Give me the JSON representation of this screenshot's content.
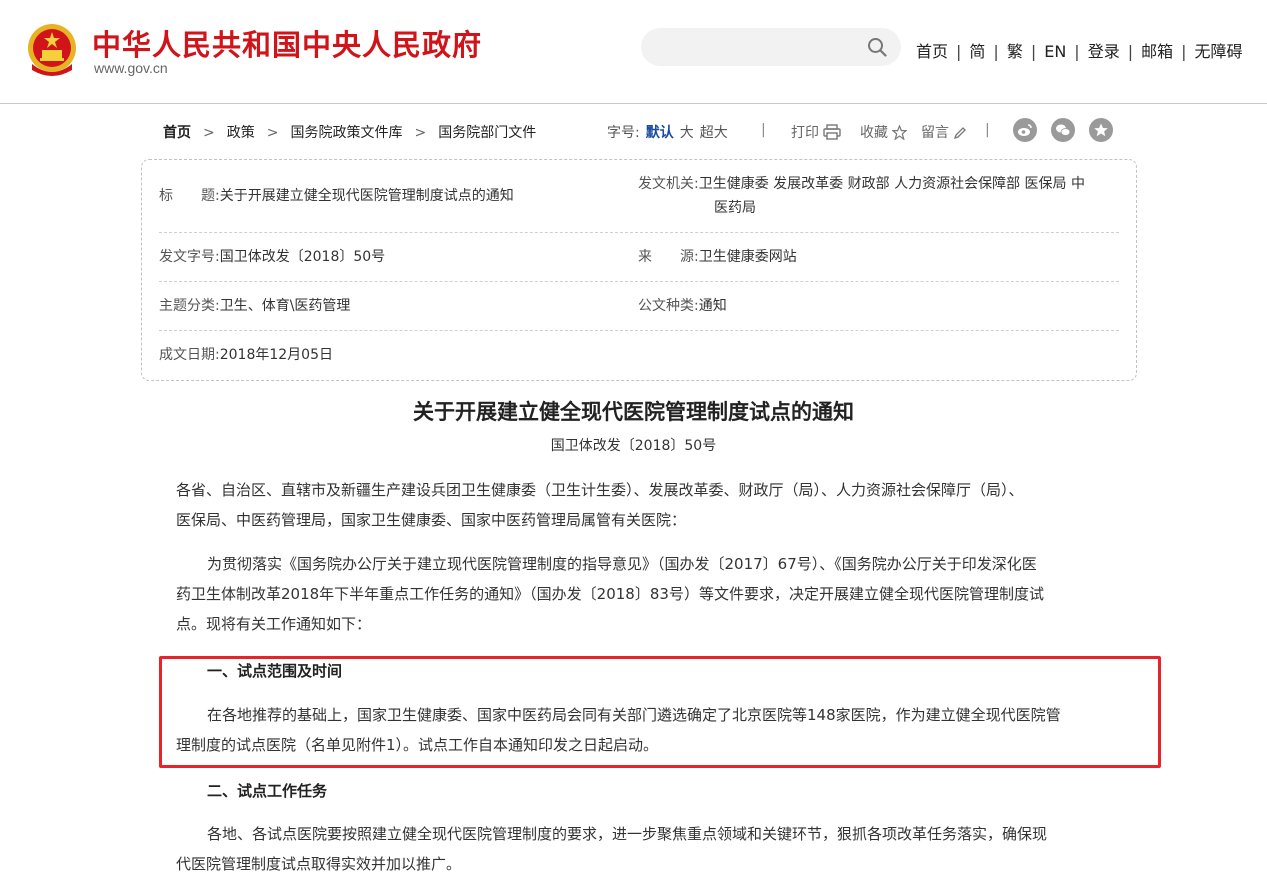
{
  "header": {
    "site_title": "中华人民共和国中央人民政府",
    "site_domain": "www.gov.cn",
    "search_placeholder": "",
    "nav": [
      "首页",
      "简",
      "繁",
      "EN",
      "登录",
      "邮箱",
      "无障碍"
    ]
  },
  "breadcrumb": [
    "首页",
    "政策",
    "国务院政策文件库",
    "国务院部门文件"
  ],
  "font_size": {
    "label": "字号:",
    "options": [
      "默认",
      "大",
      "超大"
    ],
    "selected": "默认"
  },
  "tools": {
    "print": "打印",
    "favorite": "收藏",
    "message": "留言"
  },
  "share": [
    "weibo-icon",
    "wechat-icon",
    "favorite-star-icon"
  ],
  "info": {
    "title_label": "标　　题:",
    "title_value": "关于开展建立健全现代医院管理制度试点的通知",
    "issuer_label": "发文机关:",
    "issuer_value_line1": "卫生健康委 发展改革委 财政部 人力资源社会保障部 医保局 中",
    "issuer_value_line2": "医药局",
    "doc_number_label": "发文字号:",
    "doc_number_value": "国卫体改发〔2018〕50号",
    "source_label": "来　　源:",
    "source_value": "卫生健康委网站",
    "topic_label": "主题分类:",
    "topic_value": "卫生、体育\\医药管理",
    "doc_type_label": "公文种类:",
    "doc_type_value": "通知",
    "date_label": "成文日期:",
    "date_value": "2018年12月05日"
  },
  "article": {
    "title": "关于开展建立健全现代医院管理制度试点的通知",
    "doc_no": "国卫体改发〔2018〕50号",
    "p1_line1": "各省、自治区、直辖市及新疆生产建设兵团卫生健康委（卫生计生委）、发展改革委、财政厅（局）、人力资源社会保障厅（局）、",
    "p1_line2": "医保局、中医药管理局，国家卫生健康委、国家中医药管理局属管有关医院：",
    "p2_line1": "为贯彻落实《国务院办公厅关于建立现代医院管理制度的指导意见》（国办发〔2017〕67号）、《国务院办公厅关于印发深化医",
    "p2_line2": "药卫生体制改革2018年下半年重点工作任务的通知》（国办发〔2018〕83号）等文件要求，决定开展建立健全现代医院管理制度试",
    "p2_line3": "点。现将有关工作通知如下：",
    "h1": "一、试点范围及时间",
    "p3_line1": "在各地推荐的基础上，国家卫生健康委、国家中医药局会同有关部门遴选确定了北京医院等148家医院，作为建立健全现代医院管",
    "p3_line2": "理制度的试点医院（名单见附件1）。试点工作自本通知印发之日起启动。",
    "h2": "二、试点工作任务",
    "p4_line1": "各地、各试点医院要按照建立健全现代医院管理制度的要求，进一步聚焦重点领域和关键环节，狠抓各项改革任务落实，确保现",
    "p4_line2": "代医院管理制度试点取得实效并加以推广。"
  },
  "colors": {
    "brand_red": "#d0141a",
    "highlight_red": "#e8232a",
    "link_blue": "#1b4aa0"
  }
}
